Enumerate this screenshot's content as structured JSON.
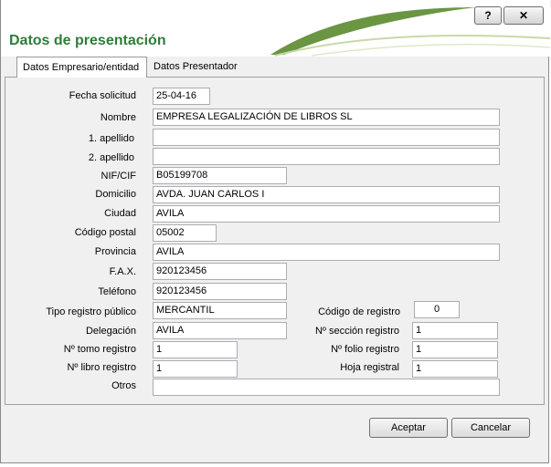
{
  "window": {
    "title": "Datos de presentación",
    "help_button": "?",
    "close_button": "✕"
  },
  "tabs": [
    {
      "label": "Datos Empresario/entidad"
    },
    {
      "label": "Datos Presentador"
    }
  ],
  "fields": {
    "fecha_solicitud": {
      "label": "Fecha solicitud",
      "value": "25-04-16"
    },
    "nombre": {
      "label": "Nombre",
      "value": "EMPRESA LEGALIZACIÓN DE LIBROS SL"
    },
    "apellido1": {
      "label": "1. apellido",
      "value": ""
    },
    "apellido2": {
      "label": "2. apellido",
      "value": ""
    },
    "nif": {
      "label": "NIF/CIF",
      "value": "B05199708"
    },
    "domicilio": {
      "label": "Domicilio",
      "value": "AVDA. JUAN CARLOS I"
    },
    "ciudad": {
      "label": "Ciudad",
      "value": "AVILA"
    },
    "codigo_postal": {
      "label": "Código postal",
      "value": "05002"
    },
    "provincia": {
      "label": "Provincia",
      "value": "AVILA"
    },
    "fax": {
      "label": "F.A.X.",
      "value": "920123456"
    },
    "telefono": {
      "label": "Teléfono",
      "value": "920123456"
    },
    "tipo_registro": {
      "label": "Tipo registro público",
      "value": "MERCANTIL"
    },
    "codigo_registro": {
      "label": "Código de registro",
      "value": "0"
    },
    "delegacion": {
      "label": "Delegación",
      "value": "AVILA"
    },
    "seccion_registro": {
      "label": "Nº sección registro",
      "value": "1"
    },
    "tomo_registro": {
      "label": "Nº tomo registro",
      "value": "1"
    },
    "folio_registro": {
      "label": "Nº folio registro",
      "value": "1"
    },
    "libro_registro": {
      "label": "Nº libro registro",
      "value": "1"
    },
    "hoja_registral": {
      "label": "Hoja registral",
      "value": "1"
    },
    "otros": {
      "label": "Otros",
      "value": ""
    }
  },
  "buttons": {
    "accept": "Aceptar",
    "cancel": "Cancelar"
  },
  "colors": {
    "title_green": "#2e7d3a",
    "swoosh_green": "#5a8a2e"
  }
}
